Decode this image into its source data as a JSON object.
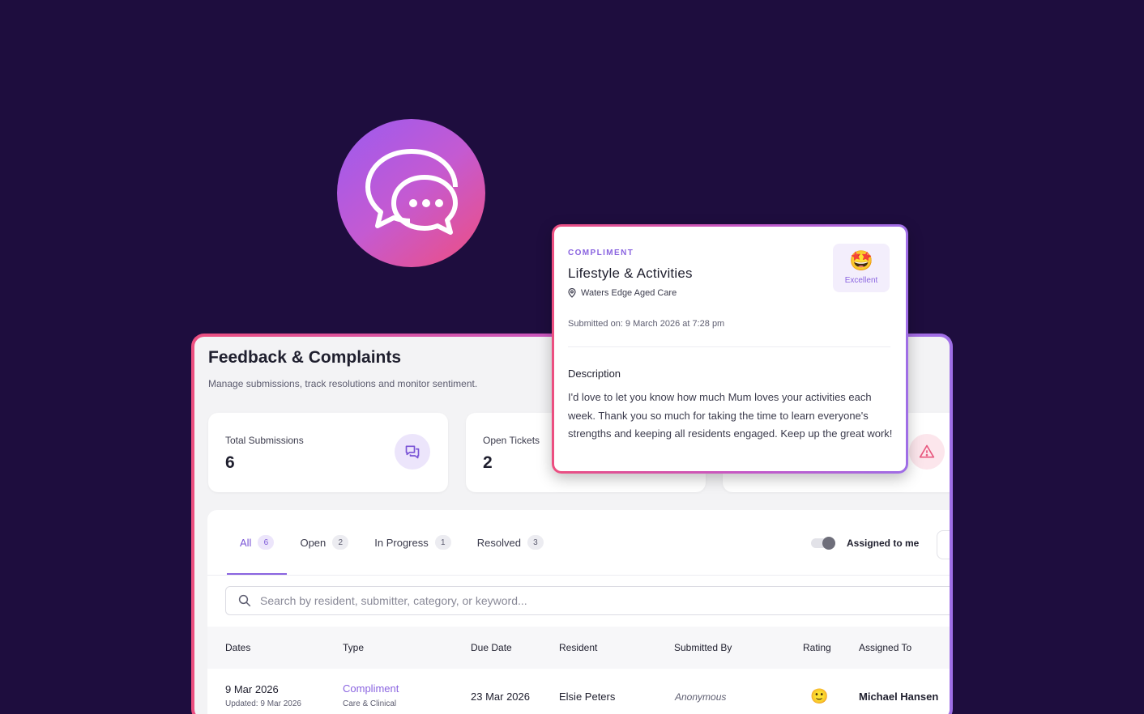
{
  "colors": {
    "background": "#1e0d3e",
    "accent": "#8a64e0",
    "brand_gradient": [
      "#9b5bf0",
      "#f04e7e"
    ],
    "danger": "#e8577e"
  },
  "app_icon": {
    "icon": "chat-bubbles-icon"
  },
  "page": {
    "title": "Feedback & Complaints",
    "subtitle": "Manage submissions, track resolutions and monitor sentiment."
  },
  "stats": [
    {
      "label": "Total Submissions",
      "value": "6",
      "icon": "chat-icon"
    },
    {
      "label": "Open Tickets",
      "value": "2"
    },
    {
      "icon": "warning-icon"
    }
  ],
  "tabs": [
    {
      "label": "All",
      "count": "6"
    },
    {
      "label": "Open",
      "count": "2"
    },
    {
      "label": "In Progress",
      "count": "1"
    },
    {
      "label": "Resolved",
      "count": "3"
    }
  ],
  "toggle": {
    "label": "Assigned to me"
  },
  "search": {
    "placeholder": "Search by resident, submitter, category, or keyword..."
  },
  "table": {
    "columns": [
      "Dates",
      "Type",
      "Due Date",
      "Resident",
      "Submitted By",
      "Rating",
      "Assigned To"
    ],
    "rows": [
      {
        "date": "9 Mar 2026",
        "updated": "Updated: 9 Mar 2026",
        "type": "Compliment",
        "category": "Care & Clinical",
        "due": "23 Mar 2026",
        "resident": "Elsie Peters",
        "submitted_by": "Anonymous",
        "rating": "🙂",
        "assigned_to": "Michael Hansen"
      }
    ]
  },
  "popup": {
    "kicker": "COMPLIMENT",
    "title": "Lifestyle & Activities",
    "location": "Waters Edge Aged Care",
    "rating_emoji": "🤩",
    "rating_label": "Excellent",
    "submitted": "Submitted on: 9 March 2026 at 7:28 pm",
    "description_heading": "Description",
    "description": "I'd love to let you know how much Mum loves your activities each week. Thank you so much for taking the time to learn everyone's strengths and keeping all residents engaged. Keep up the great work!"
  }
}
